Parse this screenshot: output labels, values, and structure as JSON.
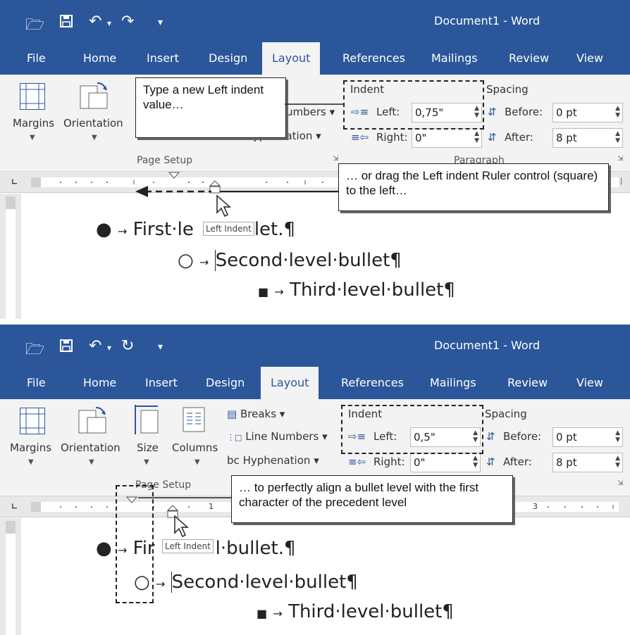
{
  "app": {
    "title": "Document1  -  Word",
    "quick_access": {
      "open_icon": "open-folder-icon",
      "save_icon": "save-icon",
      "undo_icon": "undo-icon",
      "redo_icon": "redo-icon",
      "customize_icon": "customize-qat-icon"
    }
  },
  "tabs": [
    "File",
    "Home",
    "Insert",
    "Design",
    "Layout",
    "References",
    "Mailings",
    "Review",
    "View"
  ],
  "active_tab": "Layout",
  "panel1": {
    "ribbon": {
      "margins": "Margins",
      "orientation": "Orientation",
      "line_numbers_partial": "umbers",
      "hyphenation": "Hyphenation",
      "page_setup": "Page Setup",
      "indent_label": "Indent",
      "spacing_label": "Spacing",
      "left_label": "Left:",
      "left_value": "0,75\"",
      "right_label": "Right:",
      "right_value": "0\"",
      "before_label": "Before:",
      "before_value": "0 pt",
      "after_label": "After:",
      "after_value": "8 pt",
      "paragraph_partial": "Paragraph"
    },
    "callouts": {
      "type_value": "Type a new Left indent value…",
      "drag_ruler": "… or drag the Left indent Ruler control (square) to the left…"
    },
    "tooltip": "Left Indent",
    "bullets": {
      "first_a": "First·le",
      "first_b": "let.¶",
      "second": "Second·level·bullet¶",
      "third": "Third·level·bullet¶"
    }
  },
  "panel2": {
    "ribbon": {
      "margins": "Margins",
      "orientation": "Orientation",
      "size": "Size",
      "columns": "Columns",
      "breaks": "Breaks",
      "line_numbers": "Line Numbers",
      "hyphenation": "Hyphenation",
      "page_setup": "Page Setup",
      "indent_label": "Indent",
      "spacing_label": "Spacing",
      "left_label": "Left:",
      "left_value": "0,5\"",
      "right_label": "Right:",
      "right_value": "0\"",
      "before_label": "Before:",
      "before_value": "0 pt",
      "after_label": "After:",
      "after_value": "8 pt"
    },
    "callouts": {
      "align": "… to perfectly align a bullet level with the first character of the precedent level"
    },
    "tooltip": "Left Indent",
    "ruler_numbers": [
      "1",
      "3"
    ],
    "bullets": {
      "first_a": "Fir",
      "first_b": "l·bullet.¶",
      "second": "Second·level·bullet¶",
      "third": "Third·level·bullet¶"
    }
  },
  "colors": {
    "word_blue": "#2b579a",
    "ribbon_bg": "#f3f3f3"
  }
}
